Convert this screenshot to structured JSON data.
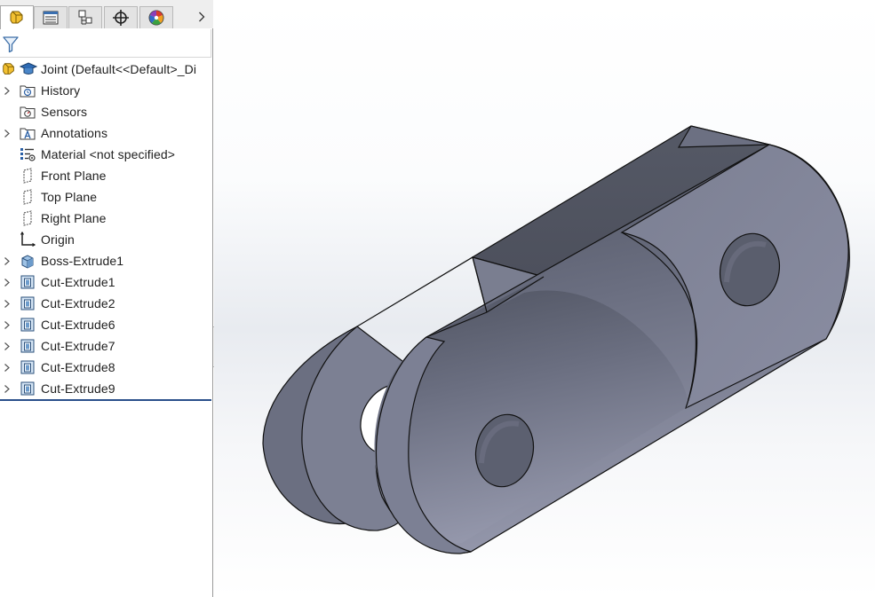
{
  "tabs": [
    {
      "name": "feature-manager",
      "icon": "feature-manager-icon",
      "active": true
    },
    {
      "name": "property-manager",
      "icon": "property-manager-icon",
      "active": false
    },
    {
      "name": "configuration-manager",
      "icon": "configuration-manager-icon",
      "active": false
    },
    {
      "name": "dimxpert-manager",
      "icon": "dimxpert-icon",
      "active": false
    },
    {
      "name": "display-manager",
      "icon": "display-manager-icon",
      "active": false
    }
  ],
  "tree": {
    "root": {
      "label": "Joint  (Default<<Default>_Di",
      "icon": "part-icon"
    },
    "items": [
      {
        "label": "History",
        "icon": "history-folder-icon",
        "expandable": true
      },
      {
        "label": "Sensors",
        "icon": "sensors-folder-icon",
        "expandable": false
      },
      {
        "label": "Annotations",
        "icon": "annotations-folder-icon",
        "expandable": true
      },
      {
        "label": "Material <not specified>",
        "icon": "material-icon",
        "expandable": false
      },
      {
        "label": "Front Plane",
        "icon": "plane-icon",
        "expandable": false
      },
      {
        "label": "Top Plane",
        "icon": "plane-icon",
        "expandable": false
      },
      {
        "label": "Right Plane",
        "icon": "plane-icon",
        "expandable": false
      },
      {
        "label": "Origin",
        "icon": "origin-icon",
        "expandable": false
      },
      {
        "label": "Boss-Extrude1",
        "icon": "boss-extrude-icon",
        "expandable": true
      },
      {
        "label": "Cut-Extrude1",
        "icon": "cut-extrude-icon",
        "expandable": true
      },
      {
        "label": "Cut-Extrude2",
        "icon": "cut-extrude-icon",
        "expandable": true
      },
      {
        "label": "Cut-Extrude6",
        "icon": "cut-extrude-icon",
        "expandable": true
      },
      {
        "label": "Cut-Extrude7",
        "icon": "cut-extrude-icon",
        "expandable": true
      },
      {
        "label": "Cut-Extrude8",
        "icon": "cut-extrude-icon",
        "expandable": true
      },
      {
        "label": "Cut-Extrude9",
        "icon": "cut-extrude-icon",
        "expandable": true
      }
    ]
  },
  "colors": {
    "part_face_light": "#8a8ea3",
    "part_face_dark": "#4e5260",
    "rollback_bar": "#2a4f8a"
  }
}
